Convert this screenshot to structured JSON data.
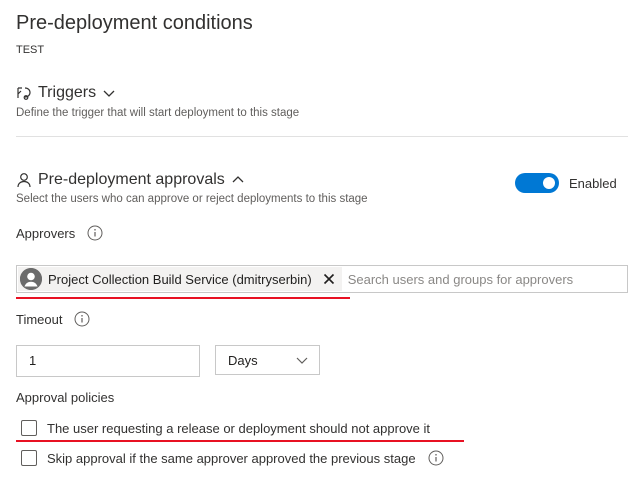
{
  "header": {
    "title": "Pre-deployment conditions",
    "stage": "TEST"
  },
  "triggers": {
    "title": "Triggers",
    "description": "Define the trigger that will start deployment to this stage",
    "icon": "trigger-icon",
    "expand_icon": "chevron-down-icon"
  },
  "approvals": {
    "title": "Pre-deployment approvals",
    "description": "Select the users who can approve or reject deployments to this stage",
    "icon": "person-icon",
    "collapse_icon": "chevron-up-icon",
    "toggle_label": "Enabled",
    "toggle_on": true,
    "accent_color": "#0078d4",
    "approvers_label": "Approvers",
    "approvers": [
      {
        "name": "Project Collection Build Service (dmitryserbin)"
      }
    ],
    "approver_search_placeholder": "Search users and groups for approvers",
    "timeout_label": "Timeout",
    "timeout_value": "1",
    "timeout_unit": "Days",
    "policies_label": "Approval policies",
    "policies": [
      {
        "label": "The user requesting a release or deployment should not approve it",
        "checked": false
      },
      {
        "label": "Skip approval if the same approver approved the previous stage",
        "checked": false
      }
    ],
    "highlight_color": "#e81123"
  }
}
